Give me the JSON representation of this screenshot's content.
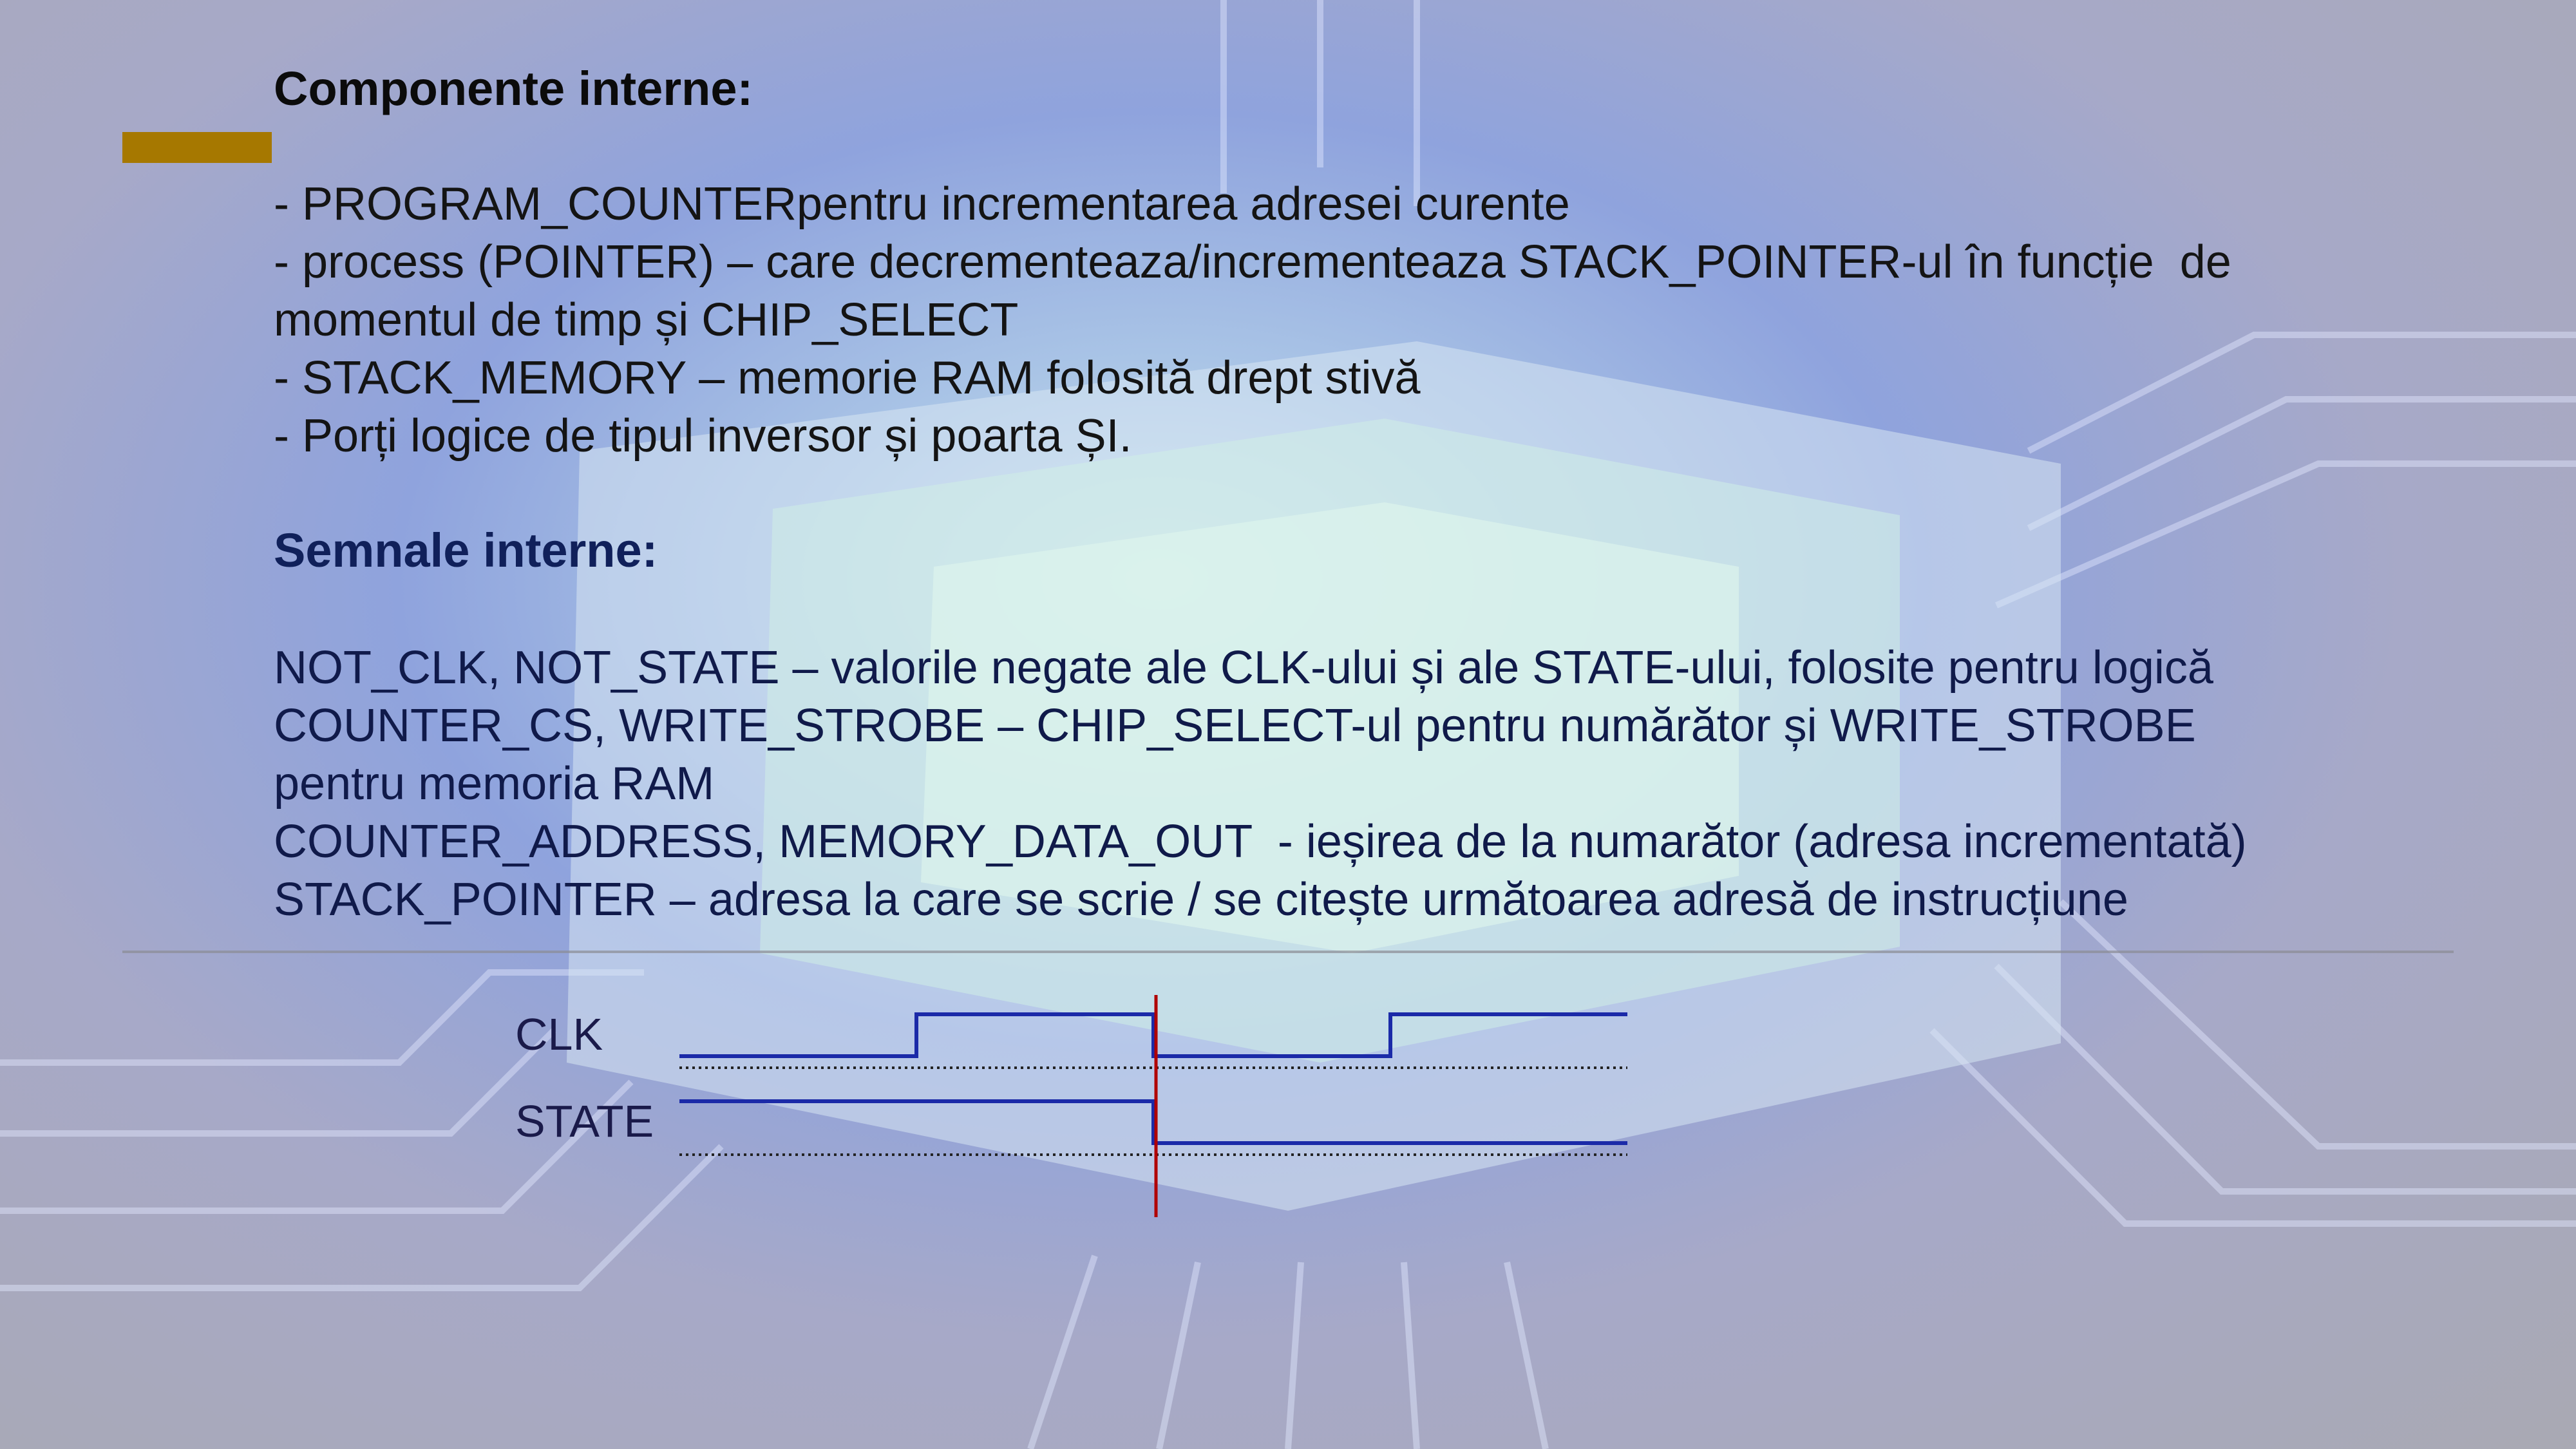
{
  "slide": {
    "components_heading": "Componente interne:",
    "components": [
      "- PROGRAM_COUNTERpentru incrementarea adresei curente",
      "- process (POINTER) – care decrementeaza/incrementeaza STACK_POINTER-ul în funcție  de",
      "momentul de timp și CHIP_SELECT",
      "- STACK_MEMORY – memorie RAM folosită drept stivă",
      "- Porți logice de tipul inversor și poarta ȘI."
    ],
    "signals_heading": "Semnale interne:",
    "signals": [
      "NOT_CLK, NOT_STATE – valorile negate ale CLK-ului și ale STATE-ului, folosite pentru logică",
      "COUNTER_CS, WRITE_STROBE – CHIP_SELECT-ul pentru numărător și WRITE_STROBE",
      "pentru memoria RAM",
      "COUNTER_ADDRESS, MEMORY_DATA_OUT  - ieșirea de la numarător (adresa incrementată)",
      "STACK_POINTER – adresa la care se scrie / se citește următoarea adresă de instrucțiune"
    ],
    "timing_diagram": {
      "signals": [
        {
          "name": "CLK",
          "levels": [
            0,
            1,
            0,
            1
          ]
        },
        {
          "name": "STATE",
          "levels": [
            1,
            1,
            0,
            0
          ]
        }
      ],
      "cursor_after_phase": 2
    },
    "colors": {
      "accent": "#a67800",
      "heading_components": "#0b0b0b",
      "heading_signals": "#10205a",
      "waveform": "#1b2aa8",
      "cursor": "#b00000"
    }
  }
}
